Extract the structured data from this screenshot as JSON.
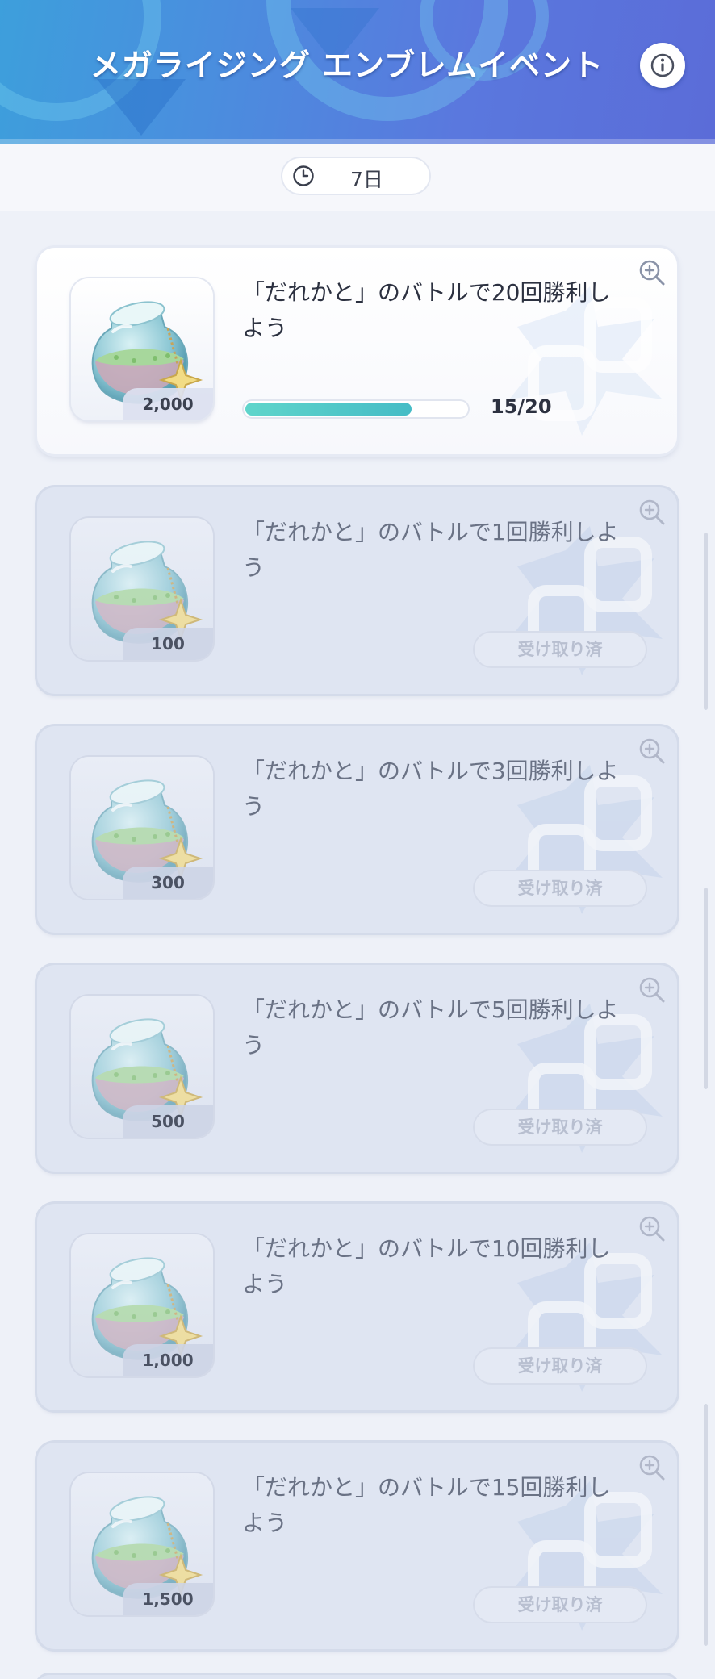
{
  "header": {
    "title": "メガライジング エンブレムイベント",
    "info_icon": "info-icon"
  },
  "timer": {
    "icon": "clock-icon",
    "text": "7日"
  },
  "missions": [
    {
      "text": "「だれかと」のバトルで20回勝利しよう",
      "reward": "2,000",
      "state": "in_progress",
      "progress": 0.75,
      "progress_label": "15/20"
    },
    {
      "text": "「だれかと」のバトルで1回勝利しよう",
      "reward": "100",
      "state": "claimed",
      "claimed_label": "受け取り済"
    },
    {
      "text": "「だれかと」のバトルで3回勝利しよう",
      "reward": "300",
      "state": "claimed",
      "claimed_label": "受け取り済"
    },
    {
      "text": "「だれかと」のバトルで5回勝利しよう",
      "reward": "500",
      "state": "claimed",
      "claimed_label": "受け取り済"
    },
    {
      "text": "「だれかと」のバトルで10回勝利しよう",
      "reward": "1,000",
      "state": "claimed",
      "claimed_label": "受け取り済"
    },
    {
      "text": "「だれかと」のバトルで15回勝利しよう",
      "reward": "1,500",
      "state": "claimed",
      "claimed_label": "受け取り済"
    }
  ],
  "colors": {
    "header_start": "#3d9fdc",
    "header_end": "#5b6cd8",
    "progress_fill": "#4fc8c8",
    "claimed_text": "#b8bfd0"
  }
}
